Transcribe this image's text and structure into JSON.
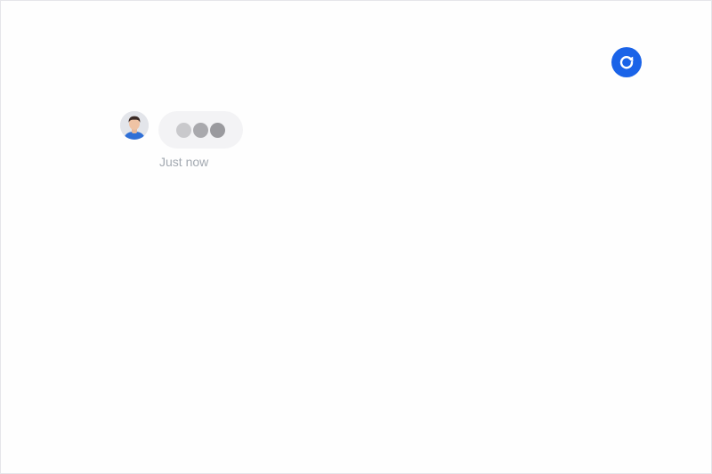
{
  "chat": {
    "message": {
      "status": "typing",
      "timestamp": "Just now",
      "avatar_icon": "user-avatar-icon"
    }
  },
  "controls": {
    "refresh_icon": "refresh-icon"
  },
  "colors": {
    "accent": "#1a63e8",
    "bubble": "#f3f3f5",
    "timestamp_text": "#a3a9b1"
  }
}
